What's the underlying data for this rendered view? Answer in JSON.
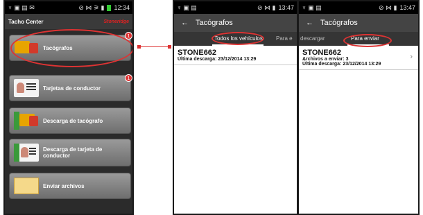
{
  "phone1": {
    "status": {
      "left": "♆ ▣ ▤ ✉",
      "right": "⊘ ⋈ ⚞ ▮",
      "time": "12:34"
    },
    "title": "Tacho Center",
    "logo": "Stoneridge",
    "menu": [
      {
        "label": "Tacógrafos",
        "icon": "truck-icon",
        "badge": "1"
      },
      {
        "label": "Tarjetas de conductor",
        "icon": "driver-card-icon",
        "badge": "1"
      },
      {
        "label": "Descarga de tacógrafo",
        "icon": "truck-download-icon",
        "badge": ""
      },
      {
        "label": "Descarga de tarjeta de conductor",
        "icon": "card-download-icon",
        "badge": ""
      },
      {
        "label": "Enviar archivos",
        "icon": "envelope-icon",
        "badge": ""
      }
    ]
  },
  "phone2": {
    "status": {
      "left": "♆ ▣ ▤",
      "right": "⊘ ⋈ ▮",
      "time": "13:47"
    },
    "back": "←",
    "title": "Tacógrafos",
    "tabs": [
      "Todos los vehículos",
      "Para e"
    ],
    "row": {
      "name": "STONE662",
      "last": "Última descarga: 23/12/2014 13:29"
    }
  },
  "phone3": {
    "status": {
      "left": "♆ ▣ ▤",
      "right": "⊘ ⋈ ▮",
      "time": "13:47"
    },
    "back": "←",
    "title": "Tacógrafos",
    "tabs": [
      "descargar",
      "Para enviar"
    ],
    "row": {
      "name": "STONE662",
      "files": "Archivos a enviar: 3",
      "last": "Última descarga: 23/12/2014 13:29",
      "chevron": "›"
    }
  },
  "colors": {
    "accent": "#dd3333",
    "actionbar": "#444444",
    "tabbar": "#353535"
  }
}
